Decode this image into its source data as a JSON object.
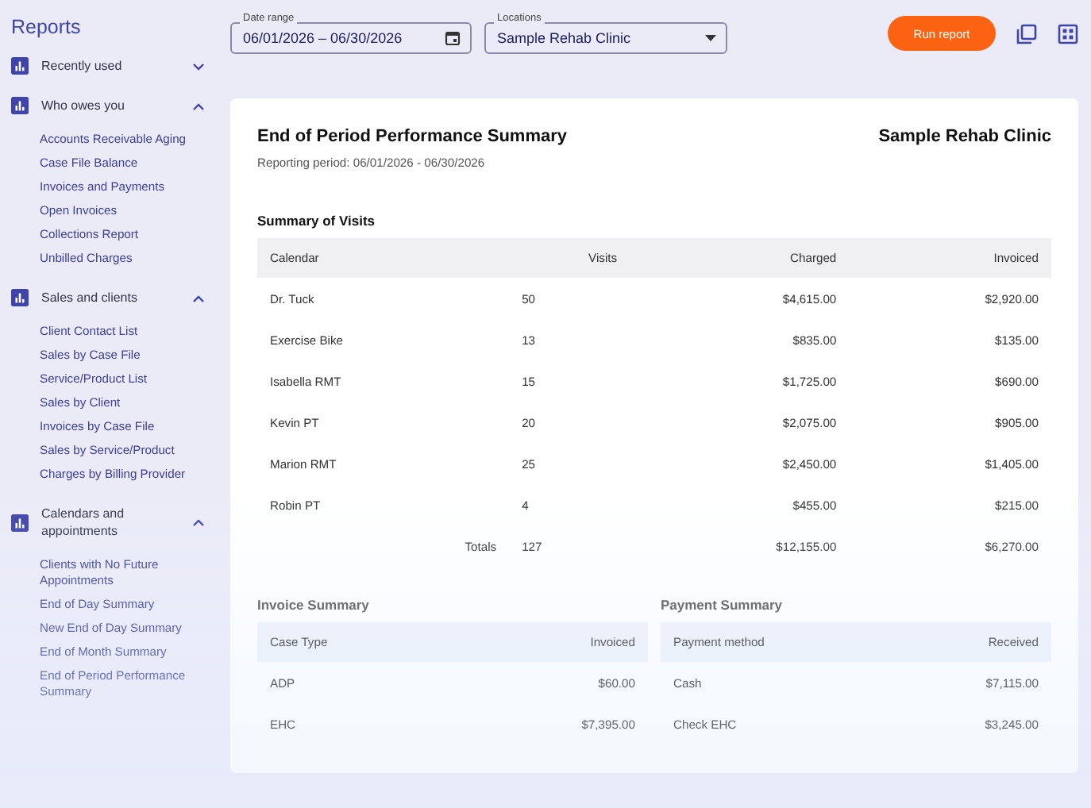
{
  "sidebar": {
    "title": "Reports",
    "groups": [
      {
        "title": "Recently used",
        "expanded": false
      },
      {
        "title": "Who owes you",
        "expanded": true,
        "items": [
          "Accounts Receivable Aging",
          "Case File Balance",
          "Invoices and Payments",
          "Open Invoices",
          "Collections Report",
          "Unbilled Charges"
        ]
      },
      {
        "title": "Sales and clients",
        "expanded": true,
        "items": [
          "Client Contact List",
          "Sales by Case File",
          "Service/Product List",
          "Sales by Client",
          "Invoices by Case File",
          "Sales by Service/Product",
          "Charges by Billing Provider"
        ]
      },
      {
        "title": "Calendars and appointments",
        "expanded": true,
        "items": [
          "Clients with No Future Appointments",
          "End of Day Summary",
          "New End of Day Summary",
          "End of Month Summary",
          "End of Period Performance Summary"
        ]
      }
    ]
  },
  "toolbar": {
    "date_range": {
      "label": "Date range",
      "value": "06/01/2026 – 06/30/2026"
    },
    "locations": {
      "label": "Locations",
      "value": "Sample Rehab Clinic"
    },
    "run_button": "Run report"
  },
  "report": {
    "title": "End of Period Performance Summary",
    "clinic": "Sample Rehab Clinic",
    "period": "Reporting period: 06/01/2026 - 06/30/2026",
    "visits": {
      "title": "Summary of Visits",
      "columns": [
        "Calendar",
        "Visits",
        "Charged",
        "Invoiced"
      ],
      "rows": [
        [
          "Dr. Tuck",
          "50",
          "$4,615.00",
          "$2,920.00"
        ],
        [
          "Exercise Bike",
          "13",
          "$835.00",
          "$135.00"
        ],
        [
          "Isabella RMT",
          "15",
          "$1,725.00",
          "$690.00"
        ],
        [
          "Kevin PT",
          "20",
          "$2,075.00",
          "$905.00"
        ],
        [
          "Marion RMT",
          "25",
          "$2,450.00",
          "$1,405.00"
        ],
        [
          "Robin PT",
          "4",
          "$455.00",
          "$215.00"
        ]
      ],
      "totals": {
        "label": "Totals",
        "values": [
          "127",
          "$12,155.00",
          "$6,270.00"
        ]
      }
    },
    "summaries": [
      {
        "title": "Invoice Summary",
        "columns": [
          "Case Type",
          "Invoiced"
        ],
        "rows": [
          [
            "ADP",
            "$60.00"
          ],
          [
            "EHC",
            "$7,395.00"
          ]
        ]
      },
      {
        "title": "Payment Summary",
        "columns": [
          "Payment method",
          "Received"
        ],
        "rows": [
          [
            "Cash",
            "$7,115.00"
          ],
          [
            "Check EHC",
            "$3,245.00"
          ]
        ]
      }
    ]
  }
}
